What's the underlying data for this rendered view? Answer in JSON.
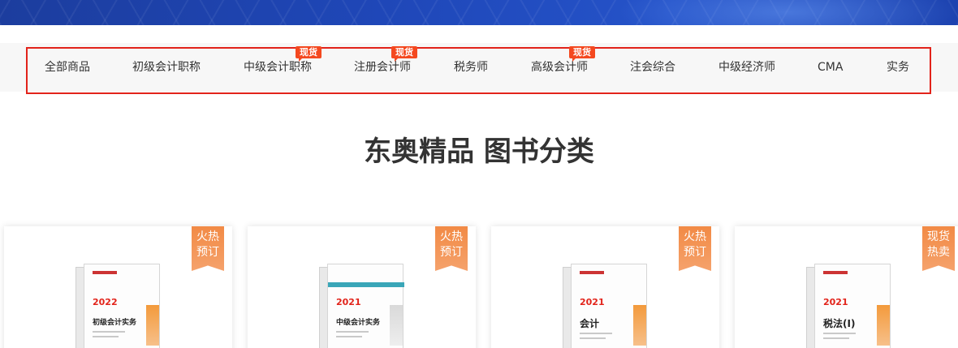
{
  "nav": {
    "items": [
      {
        "label": "全部商品"
      },
      {
        "label": "初级会计职称"
      },
      {
        "label": "中级会计职称",
        "badge": "现货"
      },
      {
        "label": "注册会计师",
        "badge": "现货"
      },
      {
        "label": "税务师"
      },
      {
        "label": "高级会计师",
        "badge": "现货"
      },
      {
        "label": "注会综合"
      },
      {
        "label": "中级经济师"
      },
      {
        "label": "CMA"
      },
      {
        "label": "实务"
      }
    ]
  },
  "section": {
    "title": "东奥精品 图书分类"
  },
  "products": [
    {
      "ribbon_line1": "火热",
      "ribbon_line2": "预订",
      "cover_year": "2022",
      "cover_title": "初级会计实务"
    },
    {
      "ribbon_line1": "火热",
      "ribbon_line2": "预订",
      "cover_year": "2021",
      "cover_title": "中级会计实务"
    },
    {
      "ribbon_line1": "火热",
      "ribbon_line2": "预订",
      "cover_year": "2021",
      "cover_title": "会计"
    },
    {
      "ribbon_line1": "现货",
      "ribbon_line2": "热卖",
      "cover_year": "2021",
      "cover_title": "税法(I)"
    }
  ],
  "colors": {
    "accent_red": "#e2231a",
    "badge_orange": "#f4481f",
    "ribbon_orange": "#f28a45",
    "banner_blue": "#1f47b8"
  }
}
